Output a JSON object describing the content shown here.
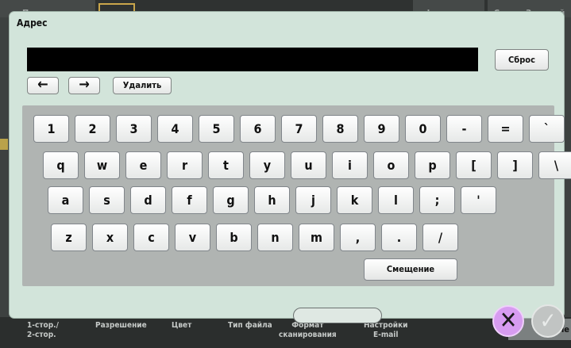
{
  "background": {
    "top_tabs": [
      "Программа",
      "Language",
      "СписокЗаданий"
    ],
    "bottom_tabs": [
      "1-стор./\n2-стор.",
      "Разрешение",
      "Цвет",
      "Тип файла",
      "Формат\nсканирования",
      "Настройки\nE-mail"
    ],
    "right_card": "ме"
  },
  "dialog": {
    "title": "Адрес",
    "address_value": "",
    "reset_label": "Сброс",
    "left_arrow": "←",
    "right_arrow": "→",
    "delete_label": "Удалить",
    "shift_label": "Смещение"
  },
  "keyboard": {
    "rows": [
      [
        "1",
        "2",
        "3",
        "4",
        "5",
        "6",
        "7",
        "8",
        "9",
        "0",
        "-",
        "=",
        "`"
      ],
      [
        "q",
        "w",
        "e",
        "r",
        "t",
        "y",
        "u",
        "i",
        "o",
        "p",
        "[",
        "]",
        "\\"
      ],
      [
        "a",
        "s",
        "d",
        "f",
        "g",
        "h",
        "j",
        "k",
        "l",
        ";",
        "'"
      ],
      [
        "z",
        "x",
        "c",
        "v",
        "b",
        "n",
        "m",
        ",",
        ".",
        "/"
      ]
    ]
  },
  "actions": {
    "cancel_symbol": "✕",
    "ok_symbol": "✓"
  },
  "colors": {
    "dialog_bg": "#d2e4da",
    "keyboard_bg": "#b0b4b2",
    "cancel_bg": "#d79cf0",
    "ok_bg": "#c1c4c3"
  }
}
